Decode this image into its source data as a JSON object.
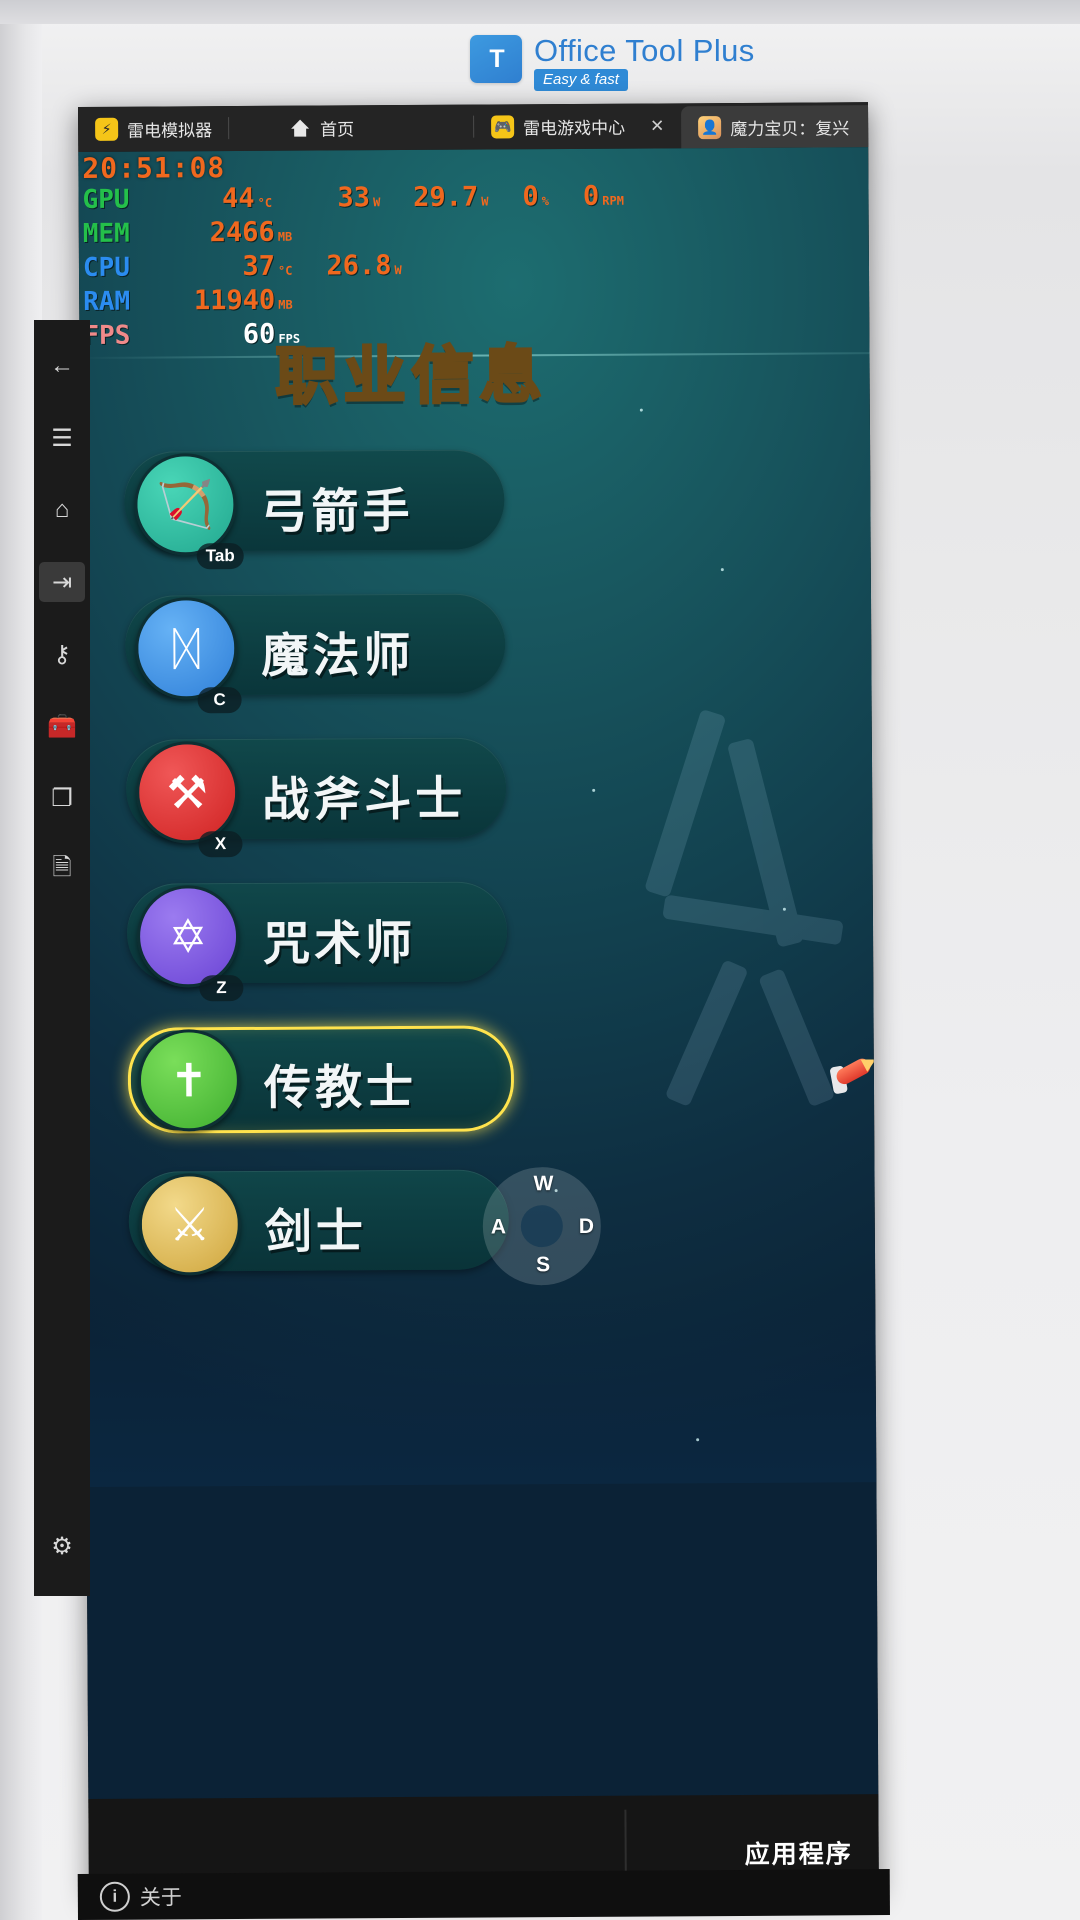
{
  "watermark": {
    "logo_glyph": "T",
    "title": "Office Tool Plus",
    "badge": "Easy & fast"
  },
  "window": {
    "tabs": [
      {
        "label": "雷电模拟器",
        "icon": "ldplayer-icon",
        "active": false,
        "closable": false
      },
      {
        "label": "首页",
        "icon": "home-icon",
        "active": false,
        "closable": false
      },
      {
        "label": "雷电游戏中心",
        "icon": "gamepad-icon",
        "active": false,
        "closable": true
      },
      {
        "label": "魔力宝贝：复兴",
        "icon": "app-avatar-icon",
        "active": true,
        "closable": true
      }
    ],
    "close_glyph": "✕"
  },
  "perf_overlay": {
    "clock": "20:51:08",
    "rows": [
      {
        "label": "GPU",
        "value1": "44",
        "unit1": "°C",
        "value2": "33",
        "unit2": "W",
        "value3": "29.7",
        "unit3": "W",
        "value4": "0",
        "unit4": "%",
        "value5": "0",
        "unit5": "RPM"
      },
      {
        "label": "MEM",
        "value1": "2466",
        "unit1": "MB"
      },
      {
        "label": "CPU",
        "value1": "37",
        "unit1": "°C",
        "value2": "26.8",
        "unit2": "W"
      },
      {
        "label": "RAM",
        "value1": "11940",
        "unit1": "MB"
      },
      {
        "label": "FPS",
        "value1": "60",
        "unit1": "FPS"
      }
    ]
  },
  "game": {
    "title": "职业信息",
    "classes": [
      {
        "name": "弓箭手",
        "key": "Tab",
        "icon": "bow-icon",
        "glyph": "🏹",
        "selected": false
      },
      {
        "name": "魔法师",
        "key": "C",
        "icon": "staff-icon",
        "glyph": "ᛞ",
        "selected": false
      },
      {
        "name": "战斧斗士",
        "key": "X",
        "icon": "axe-icon",
        "glyph": "⚒",
        "selected": false
      },
      {
        "name": "咒术师",
        "key": "Z",
        "icon": "book-icon",
        "glyph": "✡",
        "selected": false
      },
      {
        "name": "传教士",
        "key": "",
        "icon": "cross-icon",
        "glyph": "✝",
        "selected": true
      },
      {
        "name": "剑士",
        "key": "",
        "icon": "sword-icon",
        "glyph": "⚔",
        "selected": false
      }
    ],
    "dpad": {
      "up": "W",
      "left": "A",
      "right": "D",
      "down": "S"
    }
  },
  "sidebar": {
    "items": [
      {
        "name": "back-arrow-icon",
        "glyph": "←",
        "active": false
      },
      {
        "name": "menu-icon",
        "glyph": "☰",
        "active": false
      },
      {
        "name": "home-icon",
        "glyph": "⌂",
        "active": false
      },
      {
        "name": "install-apk-icon",
        "glyph": "⇥",
        "active": true
      },
      {
        "name": "keymapping-icon",
        "glyph": "⚷",
        "active": false
      },
      {
        "name": "toolbox-icon",
        "glyph": "🧰",
        "active": false
      },
      {
        "name": "multi-instance-icon",
        "glyph": "❐",
        "active": false
      },
      {
        "name": "file-transfer-icon",
        "glyph": "🗎",
        "active": false
      }
    ],
    "settings": {
      "name": "gear-icon",
      "glyph": "⚙"
    }
  },
  "taskbar": {
    "label": "应用程序"
  },
  "window_footer": {
    "label": "关于",
    "icon_glyph": "i"
  },
  "top_strip": {
    "tick_label": ""
  },
  "colors": {
    "accent_orange": "#f0681e",
    "accent_yellow": "#ffe34d",
    "brand_blue": "#2f7fd0",
    "green": "#24c04a"
  }
}
